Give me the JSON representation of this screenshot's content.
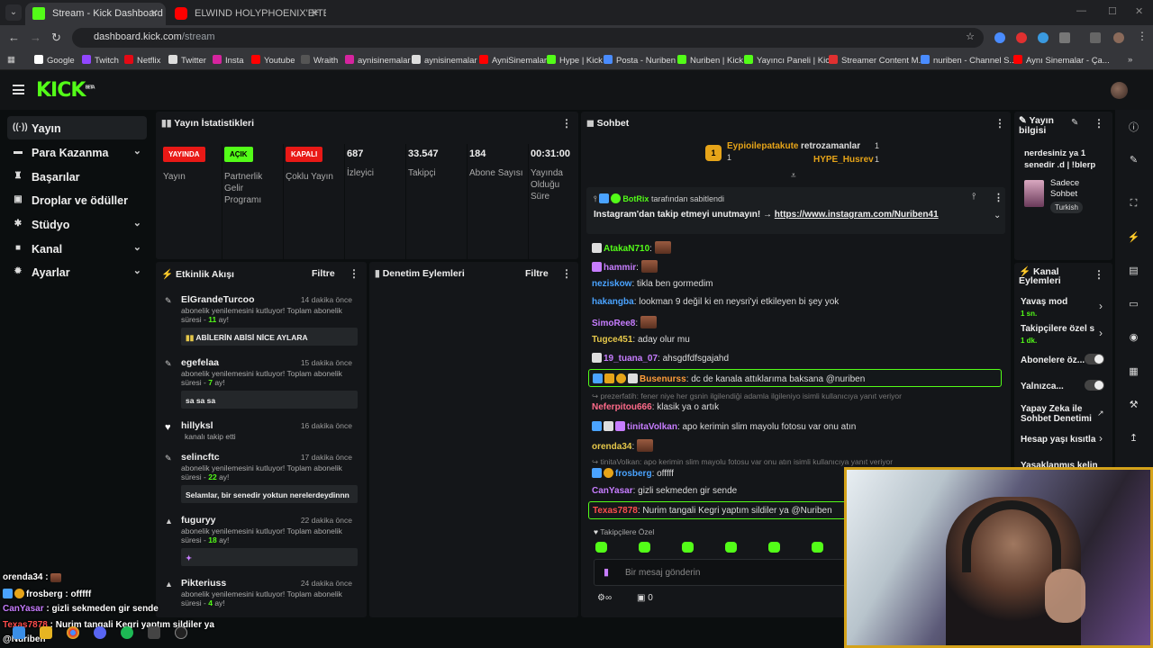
{
  "browser": {
    "tabs": [
      {
        "title": "Stream - Kick Dashboard",
        "active": true
      },
      {
        "title": "ELWIND HOLYPHOENIX'E TEK A",
        "active": false
      }
    ],
    "url_domain": "dashboard.kick.com",
    "url_path": "/stream",
    "bookmarks": [
      "Google",
      "Twitch",
      "Netflix",
      "Twitter",
      "Insta",
      "Youtube",
      "Wraith",
      "aynisinemalar",
      "aynisinemalar",
      "AyniSinemalar",
      "Hype | Kick",
      "Posta - Nuriben",
      "Nuriben | Kick",
      "Yayıncı Paneli | Kick",
      "Streamer Content M...",
      "nuriben - Channel S...",
      "Aynı Sinemalar - Ça..."
    ]
  },
  "sidebar": {
    "items": [
      {
        "label": "Yayın",
        "icon": "broadcast-icon",
        "active": true,
        "chevron": false
      },
      {
        "label": "Para Kazanma",
        "icon": "money-icon",
        "active": false,
        "chevron": true
      },
      {
        "label": "Başarılar",
        "icon": "trophy-icon",
        "active": false,
        "chevron": false
      },
      {
        "label": "Droplar ve ödüller",
        "icon": "gift-icon",
        "active": false,
        "chevron": false
      },
      {
        "label": "Stüdyo",
        "icon": "studio-icon",
        "active": false,
        "chevron": true
      },
      {
        "label": "Kanal",
        "icon": "channel-icon",
        "active": false,
        "chevron": true
      },
      {
        "label": "Ayarlar",
        "icon": "gear-icon",
        "active": false,
        "chevron": true
      }
    ]
  },
  "stats": {
    "title": "Yayın İstatistikleri",
    "badges": [
      {
        "badge": "YAYINDA",
        "label": "Yayın",
        "color": "#e91916"
      },
      {
        "badge": "AÇIK",
        "label": "Partnerlik Gelir Programı",
        "color": "#53fc18"
      },
      {
        "badge": "KAPALI",
        "label": "Çoklu Yayın",
        "color": "#e91916"
      }
    ],
    "numbers": [
      {
        "value": "687",
        "label": "İzleyici"
      },
      {
        "value": "33.547",
        "label": "Takipçi"
      },
      {
        "value": "184",
        "label": "Abone Sayısı"
      },
      {
        "value": "00:31:00",
        "label": "Yayında Olduğu Süre"
      }
    ]
  },
  "activity": {
    "title": "Etkinlik Akışı",
    "filter": "Filtre",
    "events": [
      {
        "name": "ElGrandeTurcoo",
        "time": "14 dakika önce",
        "text": "abonelik yenilemesini kutluyor! Toplam abonelik süresi - ",
        "months": "11",
        "suffix": " ay!",
        "message": "ABİLERİN ABİSİ NİCE AYLARA"
      },
      {
        "name": "egefelaa",
        "time": "15 dakika önce",
        "text": "abonelik yenilemesini kutluyor! Toplam abonelik süresi - ",
        "months": "7",
        "suffix": " ay!",
        "message": "sa sa sa"
      },
      {
        "name": "hillyksl",
        "time": "16 dakika önce",
        "text": "kanalı takip etti",
        "months": "",
        "suffix": "",
        "message": ""
      },
      {
        "name": "selincftc",
        "time": "17 dakika önce",
        "text": "abonelik yenilemesini kutluyor! Toplam abonelik süresi - ",
        "months": "22",
        "suffix": " ay!",
        "message": "Selamlar, bir senedir yoktun nerelerdeydinnn"
      },
      {
        "name": "fuguryy",
        "time": "22 dakika önce",
        "text": "abonelik yenilemesini kutluyor! Toplam abonelik süresi - ",
        "months": "18",
        "suffix": " ay!",
        "message": ""
      },
      {
        "name": "Pikteriuss",
        "time": "24 dakika önce",
        "text": "abonelik yenilemesini kutluyor! Toplam abonelik süresi - ",
        "months": "4",
        "suffix": " ay!",
        "message": ""
      }
    ]
  },
  "moderation": {
    "title": "Denetim Eylemleri",
    "filter": "Filtre"
  },
  "chat": {
    "title": "Sohbet",
    "leaderboard": [
      {
        "name": "Eypioilepatakute",
        "count": "1"
      },
      {
        "name": "retrozamanlar",
        "count": "1"
      },
      {
        "name": "HYPE_Husrev",
        "count": "1"
      }
    ],
    "pinned_by": "BotRix",
    "pinned_suffix": "tarafından sabitlendi",
    "pinned_text": "Instagram'dan takip etmeyi unutmayın! →",
    "pinned_link": "https://www.instagram.com/Nuriben41",
    "messages": [
      {
        "user": "AtakaN710",
        "color": "#53fc18",
        "text": ""
      },
      {
        "user": "hammir",
        "color": "#c77dff",
        "text": ""
      },
      {
        "user": "neziskow",
        "color": "#4aa3ff",
        "text": "tikla ben gormedim"
      },
      {
        "user": "hakangba",
        "color": "#4aa3ff",
        "text": "lookman 9 değil ki en neysri'yi etkileyen bi şey yok"
      },
      {
        "user": "SimoRee8",
        "color": "#c77dff",
        "text": ""
      },
      {
        "user": "Tugce451",
        "color": "#e6c84a",
        "text": "aday olur mu"
      },
      {
        "user": "19_tuana_07",
        "color": "#c77dff",
        "text": "ahsgdfdfsgajahd"
      },
      {
        "user": "Busenurss",
        "color": "#ff9d3a",
        "text": "dc de kanala attıklarıma baksana @nuriben"
      },
      {
        "user": "Neferpitou666",
        "color": "#ff6b8a",
        "text": "klasik ya o artık"
      },
      {
        "user": "tinitaVolkan",
        "color": "#c77dff",
        "text": "apo kerimin slim mayolu fotosu var onu atın"
      },
      {
        "user": "orenda34",
        "color": "#e6c84a",
        "text": ""
      },
      {
        "user": "frosberg",
        "color": "#4aa3ff",
        "text": "offfff"
      },
      {
        "user": "CanYasar",
        "color": "#c77dff",
        "text": "gizli sekmeden gir sende"
      },
      {
        "user": "Texas7878",
        "color": "#ff4d4d",
        "text": "Nurim tangali Kegri yaptım sildiler ya @Nuriben"
      }
    ],
    "replies": [
      "prezerfatih: fener niye her gsnin ilgilendiği adamla ilgileniyo isimli kullanıcıya yanıt veriyor",
      "tinitaVolkan: apo kerimin slim mayolu fotosu var onu atın isimli kullanıcıya yanıt veriyor"
    ],
    "follower_only": "Takipçilere Özel",
    "placeholder": "Bir mesaj gönderin",
    "points": "0"
  },
  "stream_info": {
    "title": "Yayın bilgisi",
    "stream_title": "nerdesiniz ya 1 senedir .d | !blerp",
    "category": "Sadece Sohbet",
    "tag": "Turkish"
  },
  "channel_actions": {
    "title": "Kanal Eylemleri",
    "items": [
      {
        "label": "Yavaş mod",
        "sub": "1 sn."
      },
      {
        "label": "Takipçilere özel s",
        "sub": "1 dk."
      },
      {
        "label": "Abonelere öz...",
        "sub": ""
      },
      {
        "label": "Yalnızca...",
        "sub": ""
      },
      {
        "label": "Yapay Zeka ile Sohbet Denetimi",
        "sub": ""
      },
      {
        "label": "Hesap yaşı kısıtla",
        "sub": ""
      },
      {
        "label": "Yasaklanmış kelin",
        "sub": ""
      }
    ]
  },
  "overlay": {
    "lines": [
      {
        "user": "orenda34",
        "text": " :",
        "color": "#ffffff"
      },
      {
        "user": "frosberg",
        "text": " : offfff",
        "color": "#ffffff"
      },
      {
        "user": "CanYasar",
        "text": " : gizli sekmeden gir sende",
        "color": "#c77dff"
      },
      {
        "user": "Texas7878",
        "text": " : Nurim tangali Kegri yaptım sildiler ya",
        "color": "#ff4d4d"
      },
      {
        "user": "@Nuriben",
        "text": "",
        "color": "#ffffff"
      }
    ]
  },
  "colors": {
    "accent": "#53fc18",
    "live": "#e91916",
    "cam_border": "#d4a21a"
  }
}
